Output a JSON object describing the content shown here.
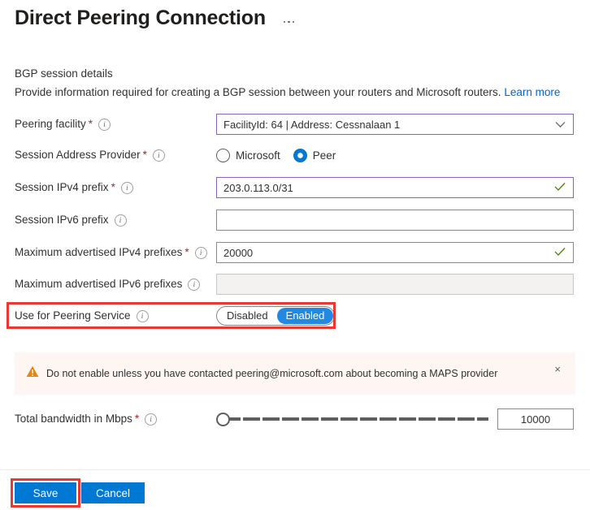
{
  "page": {
    "title": "Direct Peering Connection",
    "more_menu": "more-options"
  },
  "section": {
    "heading": "BGP session details",
    "description": "Provide information required for creating a BGP session between your routers and Microsoft routers.",
    "learn_more": "Learn more"
  },
  "fields": {
    "peering_facility": {
      "label": "Peering facility",
      "required": "*",
      "value": "FacilityId: 64 | Address: Cessnalaan 1"
    },
    "session_address_provider": {
      "label": "Session Address Provider",
      "required": "*",
      "options": [
        "Microsoft",
        "Peer"
      ],
      "option_microsoft": "Microsoft",
      "option_peer": "Peer",
      "selected": "Peer"
    },
    "session_ipv4_prefix": {
      "label": "Session IPv4 prefix",
      "required": "*",
      "value": "203.0.113.0/31",
      "placeholder": "",
      "valid": true
    },
    "session_ipv6_prefix": {
      "label": "Session IPv6 prefix",
      "required": "",
      "value": "",
      "placeholder": ""
    },
    "max_adv_ipv4": {
      "label": "Maximum advertised IPv4 prefixes",
      "required": "*",
      "value": "20000",
      "valid": true
    },
    "max_adv_ipv6": {
      "label": "Maximum advertised IPv6 prefixes",
      "required": "",
      "value": "",
      "placeholder": "",
      "disabled": true
    },
    "use_for_peering_service": {
      "label": "Use for Peering Service",
      "required": "",
      "option_off": "Disabled",
      "option_on": "Enabled",
      "selected": "Enabled"
    },
    "total_bandwidth": {
      "label": "Total bandwidth in Mbps",
      "required": "*",
      "value": "10000"
    }
  },
  "banner": {
    "icon": "warning-triangle-icon",
    "text": "Do not enable unless you have contacted peering@microsoft.com about becoming a MAPS provider",
    "close": "×"
  },
  "footer": {
    "save_label": "Save",
    "cancel_label": "Cancel"
  },
  "colors": {
    "accent": "#0078d4",
    "toggle_on": "#2289e2",
    "focus_border": "#8764b8",
    "valid_check": "#498205",
    "required_asterisk": "#a4262c",
    "link": "#0066cc",
    "banner_bg": "#fdf6f3",
    "warning": "#d83b01",
    "annotation": "#e8392e"
  },
  "icons": {
    "info": "ⓘ",
    "chevron_down": "chevron-down-icon",
    "check": "check-icon"
  }
}
